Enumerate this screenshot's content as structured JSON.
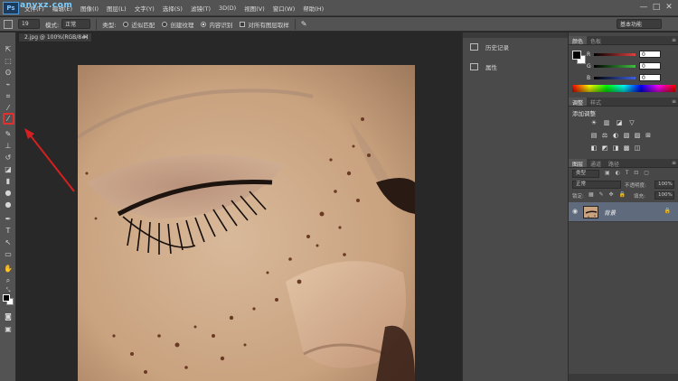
{
  "app": {
    "logo": "Ps",
    "watermark": "anyxz.com"
  },
  "menu": [
    "文件(F)",
    "编辑(E)",
    "图像(I)",
    "图层(L)",
    "文字(Y)",
    "选择(S)",
    "滤镜(T)",
    "3D(D)",
    "视图(V)",
    "窗口(W)",
    "帮助(H)"
  ],
  "window_controls": {
    "minimize": "—",
    "maximize": "□",
    "close": "✕"
  },
  "options_bar": {
    "brush_size": "19",
    "mode_label": "模式:",
    "mode_value": "正常",
    "type_label": "类型:",
    "type_options": [
      {
        "label": "近似匹配",
        "selected": false
      },
      {
        "label": "创建纹理",
        "selected": false
      },
      {
        "label": "内容识别",
        "selected": true
      }
    ],
    "sample_all_label": "对所有图层取样",
    "workspace": "基本功能"
  },
  "document_tab": {
    "title": "2.jpg @ 100%(RGB/8#)",
    "close": "×"
  },
  "mid_panels": [
    {
      "label": "历史记录",
      "icon": "history-icon"
    },
    {
      "label": "属性",
      "icon": "properties-icon"
    }
  ],
  "color_panel": {
    "tabs": [
      {
        "label": "颜色",
        "active": true
      },
      {
        "label": "色板",
        "active": false
      }
    ],
    "channels": [
      {
        "label": "R",
        "value": "0",
        "color": "#e04040"
      },
      {
        "label": "G",
        "value": "0",
        "color": "#40c040"
      },
      {
        "label": "B",
        "value": "0",
        "color": "#4060e0"
      }
    ]
  },
  "adjustments_panel": {
    "tabs": [
      {
        "label": "调整",
        "active": true
      },
      {
        "label": "样式",
        "active": false
      }
    ],
    "title": "添加调整",
    "row1_icons": [
      "☀",
      "▥",
      "◪",
      "▽"
    ],
    "row2_icons": [
      "▤",
      "⚖",
      "◐",
      "▧",
      "▨",
      "⊞"
    ],
    "row3_icons": [
      "◧",
      "◩",
      "◨",
      "▩",
      "◫"
    ]
  },
  "layers_panel": {
    "tabs": [
      {
        "label": "图层",
        "active": true
      },
      {
        "label": "通道",
        "active": false
      },
      {
        "label": "路径",
        "active": false
      }
    ],
    "filter_label": "类型",
    "blend_mode": "正常",
    "opacity_label": "不透明度:",
    "opacity_value": "100%",
    "lock_label": "锁定:",
    "fill_label": "填充:",
    "fill_value": "100%",
    "layer": {
      "name": "背景",
      "eye": "◉",
      "lock": "🔒"
    }
  },
  "colors": {
    "chrome": "#535353",
    "panel": "#474747",
    "canvas_bg": "#282828",
    "highlight": "#e03030",
    "layer_selected": "#5f6a7d"
  }
}
